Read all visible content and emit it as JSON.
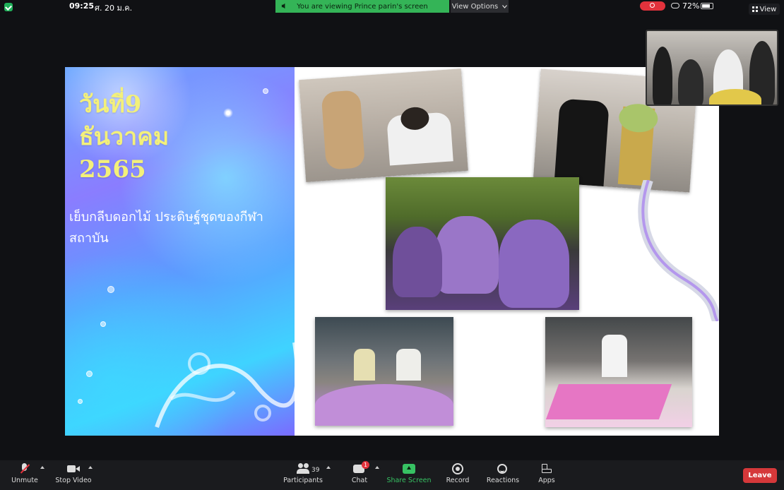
{
  "status_bar": {
    "time": "09:25",
    "date": "ศ. 20 ม.ค.",
    "battery": "72%"
  },
  "banner": {
    "text": "You are viewing Prince parin's screen",
    "view_options": "View Options"
  },
  "view_button": "View",
  "slide": {
    "title_lines": [
      "วันที่9",
      "ธันวาคม",
      "2565"
    ],
    "subtitle": "เย็บกลีบดอกไม้ ประดิษฐ์ชุดของกีฬาสถาบัน"
  },
  "toolbar": {
    "unmute": "Unmute",
    "stop_video": "Stop Video",
    "participants": "Participants",
    "participants_count": "39",
    "chat": "Chat",
    "chat_badge": "1",
    "share_screen": "Share Screen",
    "record": "Record",
    "reactions": "Reactions",
    "apps": "Apps",
    "leave": "Leave"
  },
  "colors": {
    "banner_green": "#34b457",
    "leave_red": "#d5383a",
    "title_yellow": "#f3f07a"
  }
}
